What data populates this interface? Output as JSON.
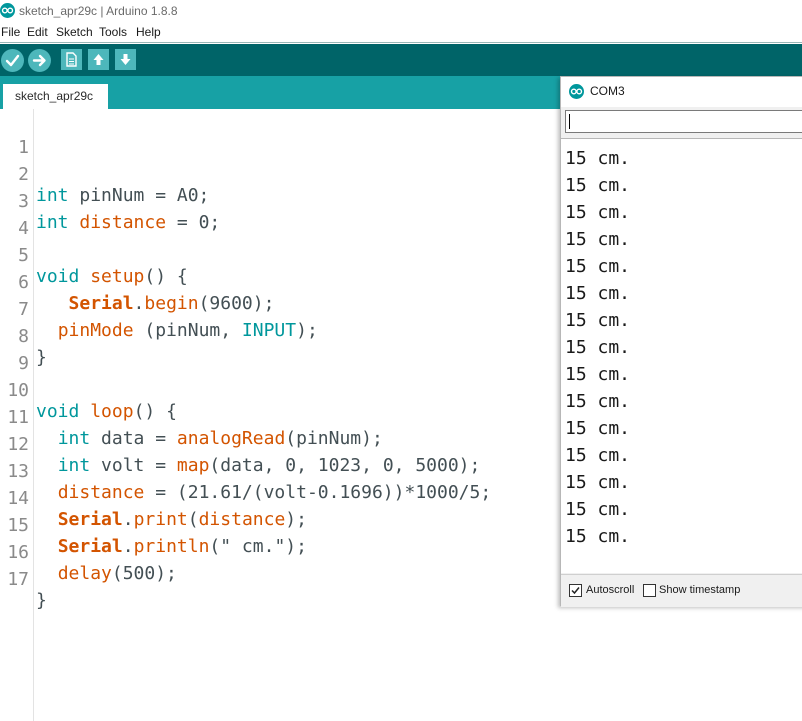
{
  "app": {
    "title": "sketch_apr29c | Arduino 1.8.8",
    "logo_icon": "arduino-infinity-logo"
  },
  "menu": [
    "File",
    "Edit",
    "Sketch",
    "Tools",
    "Help"
  ],
  "toolbar": {
    "buttons": [
      "verify-icon",
      "upload-icon",
      "new-icon",
      "open-icon",
      "save-icon"
    ]
  },
  "tabs": [
    {
      "label": "sketch_apr29c",
      "active": true
    }
  ],
  "editor": {
    "lines": [
      {
        "n": "1"
      },
      {
        "n": "2"
      },
      {
        "n": "3"
      },
      {
        "n": "4"
      },
      {
        "n": "5"
      },
      {
        "n": "6"
      },
      {
        "n": "7"
      },
      {
        "n": "8"
      },
      {
        "n": "9"
      },
      {
        "n": "10"
      },
      {
        "n": "11"
      },
      {
        "n": "12"
      },
      {
        "n": "13"
      },
      {
        "n": "14"
      },
      {
        "n": "15"
      },
      {
        "n": "16"
      },
      {
        "n": "17"
      }
    ],
    "code": {
      "l2": [
        "int",
        " pinNum = A0;"
      ],
      "l3": [
        "int",
        " ",
        "distance",
        " = 0;"
      ],
      "l5": [
        "void",
        " ",
        "setup",
        "() {"
      ],
      "l6": [
        "   ",
        "Serial",
        ".",
        "begin",
        "(9600);"
      ],
      "l7": [
        "  ",
        "pinMode",
        " (pinNum, ",
        "INPUT",
        ");"
      ],
      "l8": [
        "}"
      ],
      "l10": [
        "void",
        " ",
        "loop",
        "() {"
      ],
      "l11": [
        "  ",
        "int",
        " data = ",
        "analogRead",
        "(pinNum);"
      ],
      "l12": [
        "  ",
        "int",
        " volt = ",
        "map",
        "(data, 0, 1023, 0, 5000);"
      ],
      "l13": [
        "  ",
        "distance",
        " = (21.61/(volt-0.1696))*1000/5;"
      ],
      "l14": [
        "  ",
        "Serial",
        ".",
        "print",
        "(",
        "distance",
        ");"
      ],
      "l15": [
        "  ",
        "Serial",
        ".",
        "println",
        "(\" cm.\");"
      ],
      "l16": [
        "  ",
        "delay",
        "(500);"
      ],
      "l17": [
        "}"
      ]
    }
  },
  "serial_monitor": {
    "title": "COM3",
    "input_value": "",
    "output": [
      "15 cm.",
      "15 cm.",
      "15 cm.",
      "15 cm.",
      "15 cm.",
      "15 cm.",
      "15 cm.",
      "15 cm.",
      "15 cm.",
      "15 cm.",
      "15 cm.",
      "15 cm.",
      "15 cm.",
      "15 cm.",
      "15 cm."
    ],
    "autoscroll": {
      "label": "Autoscroll",
      "checked": true
    },
    "timestamp": {
      "label": "Show timestamp",
      "checked": false
    }
  },
  "colors": {
    "toolbar": "#006468",
    "tabbar": "#17a1a5",
    "button": "#4db7bb",
    "keyword": "#00979c",
    "function": "#d35400"
  }
}
